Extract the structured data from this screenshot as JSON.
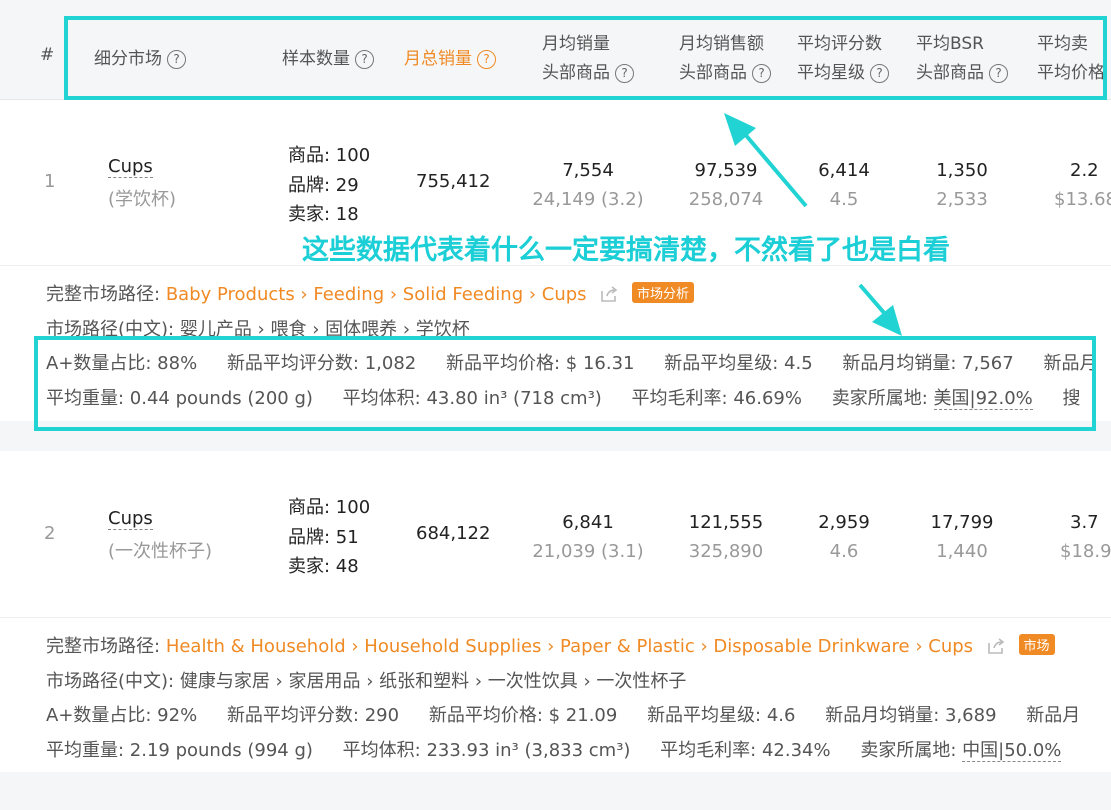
{
  "header": {
    "index": "#",
    "market": "细分市场",
    "sample": "样本数量",
    "monthly_total": "月总销量",
    "col_sales": [
      "月均销量",
      "头部商品"
    ],
    "col_revenue": [
      "月均销售额",
      "头部商品"
    ],
    "col_rating": [
      "平均评分数",
      "平均星级"
    ],
    "col_bsr": [
      "平均BSR",
      "头部商品"
    ],
    "col_price": [
      "平均卖",
      "平均价格"
    ]
  },
  "rows": [
    {
      "index": "1",
      "name": "Cups",
      "name_cn": "(学饮杯)",
      "sample": [
        "商品: 100",
        "品牌: 29",
        "卖家: 18"
      ],
      "monthly_total": "755,412",
      "sales": [
        "7,554",
        "24,149 (3.2)"
      ],
      "revenue": [
        "97,539",
        "258,074"
      ],
      "rating": [
        "6,414",
        "4.5"
      ],
      "bsr": [
        "1,350",
        "2,533"
      ],
      "price": [
        "2.2",
        "$13.68"
      ],
      "path_label": "完整市场路径:",
      "path": "Baby Products › Feeding › Solid Feeding › Cups",
      "tag": "市场分析",
      "path_cn": "市场路径(中文): 婴儿产品 › 喂食 › 固体喂养 › 学饮杯",
      "stats_line1": [
        "A+数量占比: 88%",
        "新品平均评分数: 1,082",
        "新品平均价格: $ 16.31",
        "新品平均星级: 4.5",
        "新品月均销量: 7,567",
        "新品月"
      ],
      "stats_line2_a": [
        "平均重量: 0.44 pounds (200 g)",
        "平均体积: 43.80 in³ (718 cm³)",
        "平均毛利率: 46.69%",
        "卖家所属地: "
      ],
      "origin": "美国|92.0%",
      "trail": "搜"
    },
    {
      "index": "2",
      "name": "Cups",
      "name_cn": "(一次性杯子)",
      "sample": [
        "商品: 100",
        "品牌: 51",
        "卖家: 48"
      ],
      "monthly_total": "684,122",
      "sales": [
        "6,841",
        "21,039 (3.1)"
      ],
      "revenue": [
        "121,555",
        "325,890"
      ],
      "rating": [
        "2,959",
        "4.6"
      ],
      "bsr": [
        "17,799",
        "1,440"
      ],
      "price": [
        "3.7",
        "$18.9"
      ],
      "path_label": "完整市场路径:",
      "path": "Health & Household › Household Supplies › Paper & Plastic › Disposable Drinkware › Cups",
      "tag": "市场",
      "path_cn": "市场路径(中文): 健康与家居 › 家居用品 › 纸张和塑料 › 一次性饮具 › 一次性杯子",
      "stats_line1": [
        "A+数量占比: 92%",
        "新品平均评分数: 290",
        "新品平均价格: $ 21.09",
        "新品平均星级: 4.6",
        "新品月均销量: 3,689",
        "新品月"
      ],
      "stats_line2_a": [
        "平均重量: 2.19 pounds (994 g)",
        "平均体积: 233.93 in³ (3,833 cm³)",
        "平均毛利率: 42.34%",
        "卖家所属地: "
      ],
      "origin": "中国|50.0%"
    }
  ],
  "annotation": "这些数据代表着什么一定要搞清楚，不然看了也是白看",
  "colors": {
    "accent": "#f08a24",
    "annotation": "#22d3d3"
  }
}
